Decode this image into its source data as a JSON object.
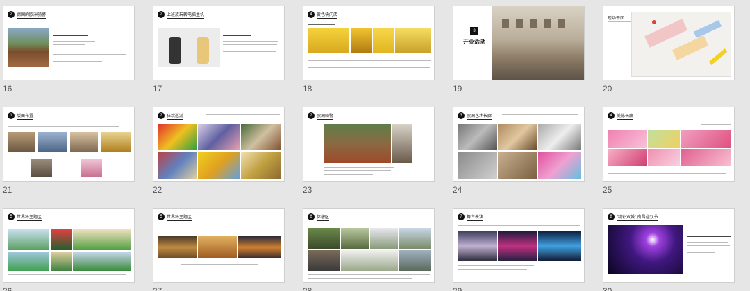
{
  "slides": [
    {
      "number": "16",
      "badge": "2",
      "title": "德国的欧洲骑警"
    },
    {
      "number": "17",
      "badge": "2",
      "title": "上班族玩转电脑主机"
    },
    {
      "number": "18",
      "badge": "4",
      "title": "黄色快闪店"
    },
    {
      "number": "19",
      "badge": "3",
      "title": "开业活动"
    },
    {
      "number": "20",
      "badge": "",
      "title": "现场平面"
    },
    {
      "number": "21",
      "badge": "1",
      "title": "版面布置"
    },
    {
      "number": "22",
      "badge": "2",
      "title": "狂欢巡游"
    },
    {
      "number": "23",
      "badge": "2",
      "title": "欧洲骑警"
    },
    {
      "number": "24",
      "badge": "3",
      "title": "欧洲艺术长廊"
    },
    {
      "number": "25",
      "badge": "4",
      "title": "美陈长廊"
    },
    {
      "number": "26",
      "badge": "5",
      "title": "世界杯主题区"
    },
    {
      "number": "27",
      "badge": "5",
      "title": "世界杯主题区"
    },
    {
      "number": "28",
      "badge": "6",
      "title": "休憩区"
    },
    {
      "number": "29",
      "badge": "7",
      "title": "舞台表演"
    },
    {
      "number": "30",
      "badge": "8",
      "title": "“精彩双城” 南昌迎双节"
    }
  ],
  "colors": {
    "background": "#e6e6e6",
    "slide": "#ffffff",
    "accent": "#111111"
  }
}
